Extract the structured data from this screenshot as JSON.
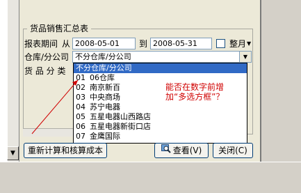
{
  "group": {
    "title": "货品销售汇总表"
  },
  "period": {
    "label": "报表期间",
    "from_label": "从",
    "from_value": "2008-05-01",
    "to_label": "到",
    "to_value": "2008-05-31",
    "whole_month_label": "整月",
    "whole_month_checked": false
  },
  "warehouse": {
    "label": "仓库/分公司",
    "value": "不分仓库/分公司"
  },
  "category": {
    "label": "货 品 分 类"
  },
  "dropdown": {
    "items": [
      {
        "code": "",
        "name": "不分仓库/分公司",
        "selected": true
      },
      {
        "code": "01",
        "name": "06仓库"
      },
      {
        "code": "02",
        "name": "南京新百"
      },
      {
        "code": "03",
        "name": "中央商场"
      },
      {
        "code": "04",
        "name": "苏宁电器"
      },
      {
        "code": "05",
        "name": "五星电器山西路店"
      },
      {
        "code": "06",
        "name": "五星电器新街口店"
      },
      {
        "code": "07",
        "name": "金鹰国际"
      }
    ]
  },
  "annotation": {
    "text": "能否在数字前增加“多选方框”？",
    "color": "#d00000"
  },
  "buttons": {
    "recalc_label": "重新计算和核算成本",
    "view_label": "查看(V)",
    "close_label": "关闭(C)"
  }
}
